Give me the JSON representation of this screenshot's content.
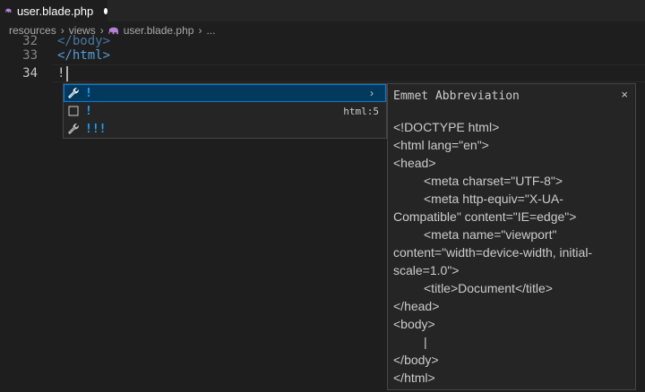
{
  "tab": {
    "label": "user.blade.php",
    "dirty": true,
    "icon": "blade-elephant-icon",
    "icon_color": "#b180d7"
  },
  "breadcrumb": {
    "items": [
      "resources",
      "views",
      "user.blade.php",
      "..."
    ]
  },
  "editor": {
    "lines": [
      {
        "number": "32",
        "text": "</body>"
      },
      {
        "number": "33",
        "text": "</html>"
      },
      {
        "number": "34",
        "text": "!"
      }
    ]
  },
  "suggest": {
    "items": [
      {
        "icon": "wrench-icon",
        "label": "!",
        "detail": "",
        "selected": true
      },
      {
        "icon": "snippet-icon",
        "label": "!",
        "detail": "html:5",
        "selected": false
      },
      {
        "icon": "wrench-icon",
        "label": "!!!",
        "detail": "",
        "selected": false
      }
    ],
    "expand": "›"
  },
  "details": {
    "title": "Emmet Abbreviation",
    "close": "×",
    "lines": [
      "<!DOCTYPE html>",
      "<html lang=\"en\">",
      "<head>",
      "\t<meta charset=\"UTF-8\">",
      "\t<meta http-equiv=\"X-UA-Compatible\" content=\"IE=edge\">",
      "\t<meta name=\"viewport\" content=\"width=device-width, initial-scale=1.0\">",
      "\t<title>Document</title>",
      "</head>",
      "<body>",
      "\t|",
      "</body>",
      "</html>"
    ]
  },
  "colors": {
    "accent": "#18a3ff",
    "selection": "#04395e",
    "tag": "#569cd6"
  }
}
